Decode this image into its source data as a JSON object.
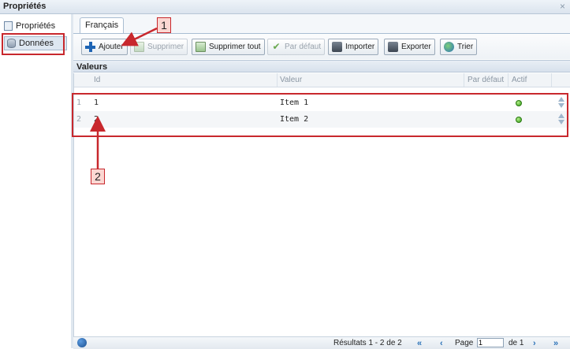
{
  "window": {
    "title": "Propriétés",
    "close_symbol": "×"
  },
  "sidebar": {
    "items": [
      {
        "label": "Propriétés",
        "icon": "properties-icon",
        "selected": false
      },
      {
        "label": "Données",
        "icon": "database-icon",
        "selected": true
      }
    ]
  },
  "tabs": [
    {
      "label": "Français",
      "active": true
    }
  ],
  "toolbar": {
    "buttons": [
      {
        "label": "Ajouter",
        "icon": "add-icon",
        "enabled": true
      },
      {
        "label": "Supprimer",
        "icon": "delete-icon",
        "enabled": false
      },
      {
        "label": "Supprimer tout",
        "icon": "delete-all-icon",
        "enabled": true
      },
      {
        "label": "Par défaut",
        "icon": "default-check-icon",
        "enabled": false
      },
      {
        "label": "Importer",
        "icon": "import-icon",
        "enabled": true
      },
      {
        "label": "Exporter",
        "icon": "export-icon",
        "enabled": true
      },
      {
        "label": "Trier",
        "icon": "sort-icon",
        "enabled": true
      }
    ]
  },
  "grid": {
    "section_title": "Valeurs",
    "columns": [
      "Id",
      "Valeur",
      "Par défaut",
      "Actif"
    ],
    "rows": [
      {
        "row_number": "1",
        "id": "1",
        "value": "Item 1",
        "default": "",
        "active": true
      },
      {
        "row_number": "2",
        "id": "2",
        "value": "Item 2",
        "default": "",
        "active": true
      }
    ]
  },
  "pager": {
    "results_text": "Résultats 1 - 2 de 2",
    "page_label": "Page",
    "page_value": "1",
    "of_text": "de 1"
  },
  "annotations": [
    {
      "label": "1"
    },
    {
      "label": "2"
    }
  ],
  "colors": {
    "annotation_red": "#c8282d",
    "annotation_fill": "#fbd7d2",
    "active_green": "#2f9a14"
  }
}
